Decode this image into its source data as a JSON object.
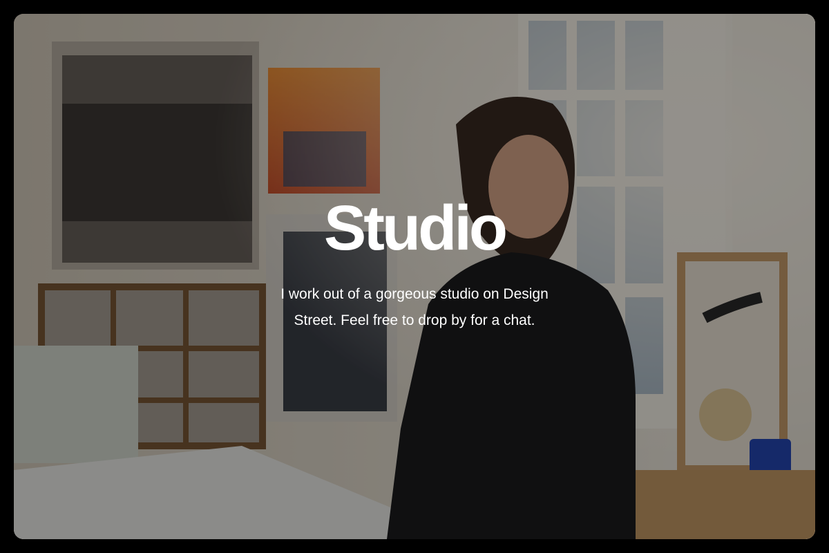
{
  "hero": {
    "title": "Studio",
    "description": "I work out of a gorgeous studio on Design Street. Feel free to drop by for a chat."
  },
  "colors": {
    "page_background": "#000000",
    "text": "#ffffff",
    "overlay": "rgba(0,0,0,0.42)"
  }
}
